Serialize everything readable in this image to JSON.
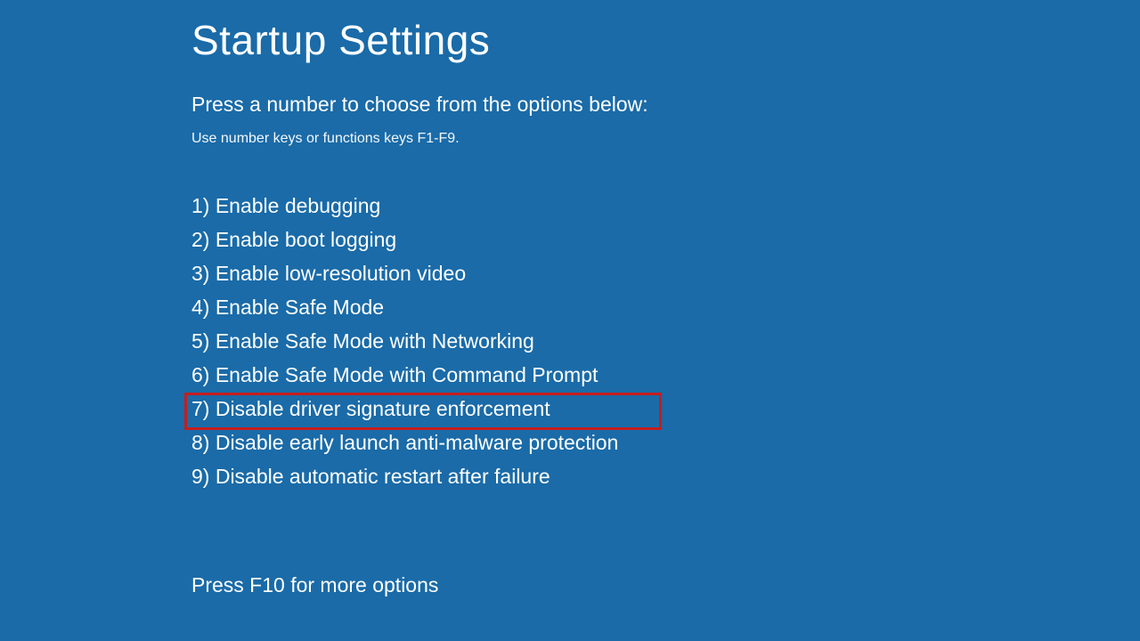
{
  "title": "Startup Settings",
  "instruction": "Press a number to choose from the options below:",
  "hint": "Use number keys or functions keys F1-F9.",
  "options": [
    "1) Enable debugging",
    "2) Enable boot logging",
    "3) Enable low-resolution video",
    "4) Enable Safe Mode",
    "5) Enable Safe Mode with Networking",
    "6) Enable Safe Mode with Command Prompt",
    "7) Disable driver signature enforcement",
    "8) Disable early launch anti-malware protection",
    "9) Disable automatic restart after failure"
  ],
  "highlighted_index": 6,
  "footer": "Press F10 for more options"
}
